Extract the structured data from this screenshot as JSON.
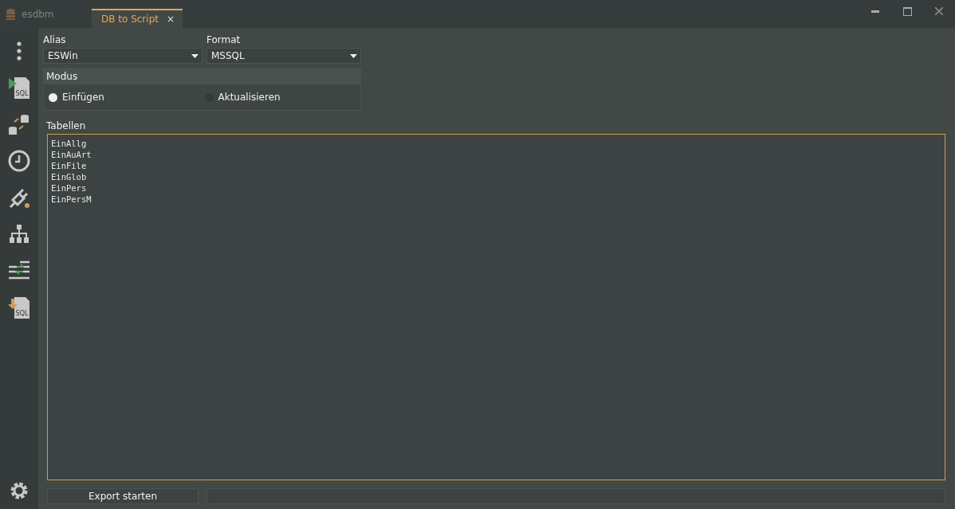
{
  "app": {
    "title": "esdbm"
  },
  "tabs": [
    {
      "label": "DB to Script",
      "close": "×",
      "selected": true
    }
  ],
  "sidebar": [
    {
      "kind": "more"
    },
    {
      "kind": "run-sql",
      "text": "SQL"
    },
    {
      "kind": "db-sync"
    },
    {
      "kind": "clock"
    },
    {
      "kind": "plug"
    },
    {
      "kind": "tree"
    },
    {
      "kind": "compare"
    },
    {
      "kind": "export-sql",
      "text": "SQL"
    },
    {
      "kind": "gear"
    }
  ],
  "alias": {
    "label": "Alias",
    "value": "ESWin"
  },
  "format": {
    "label": "Format",
    "value": "MSSQL"
  },
  "modus": {
    "title": "Modus",
    "options": [
      {
        "label": "Einfügen",
        "selected": true
      },
      {
        "label": "Aktualisieren",
        "selected": false
      }
    ]
  },
  "tables": {
    "label": "Tabellen",
    "lines": [
      "EinAllg",
      "EinAuArt",
      "EinFile",
      "EinGlob",
      "EinPers",
      "EinPersM"
    ]
  },
  "export_button": "Export starten",
  "progress": {
    "level": 0
  }
}
